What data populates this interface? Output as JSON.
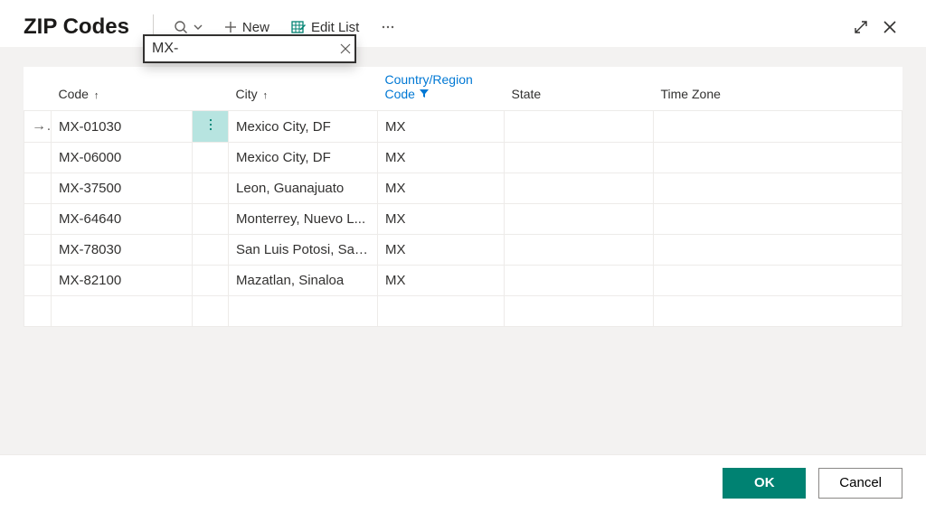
{
  "header": {
    "title": "ZIP Codes",
    "new_label": "New",
    "edit_label": "Edit List"
  },
  "search": {
    "value": "MX-"
  },
  "columns": {
    "code": "Code",
    "city": "City",
    "country": "Country/Region Code",
    "state": "State",
    "timezone": "Time Zone"
  },
  "rows": [
    {
      "code": "MX-01030",
      "city": "Mexico City, DF",
      "country": "MX",
      "state": "",
      "tz": ""
    },
    {
      "code": "MX-06000",
      "city": "Mexico City, DF",
      "country": "MX",
      "state": "",
      "tz": ""
    },
    {
      "code": "MX-37500",
      "city": "Leon, Guanajuato",
      "country": "MX",
      "state": "",
      "tz": ""
    },
    {
      "code": "MX-64640",
      "city": "Monterrey, Nuevo L...",
      "country": "MX",
      "state": "",
      "tz": ""
    },
    {
      "code": "MX-78030",
      "city": "San Luis Potosi, San...",
      "country": "MX",
      "state": "",
      "tz": ""
    },
    {
      "code": "MX-82100",
      "city": "Mazatlan, Sinaloa",
      "country": "MX",
      "state": "",
      "tz": ""
    }
  ],
  "footer": {
    "ok": "OK",
    "cancel": "Cancel"
  },
  "colors": {
    "primary": "#008272",
    "highlight": "#b7e4e0"
  }
}
